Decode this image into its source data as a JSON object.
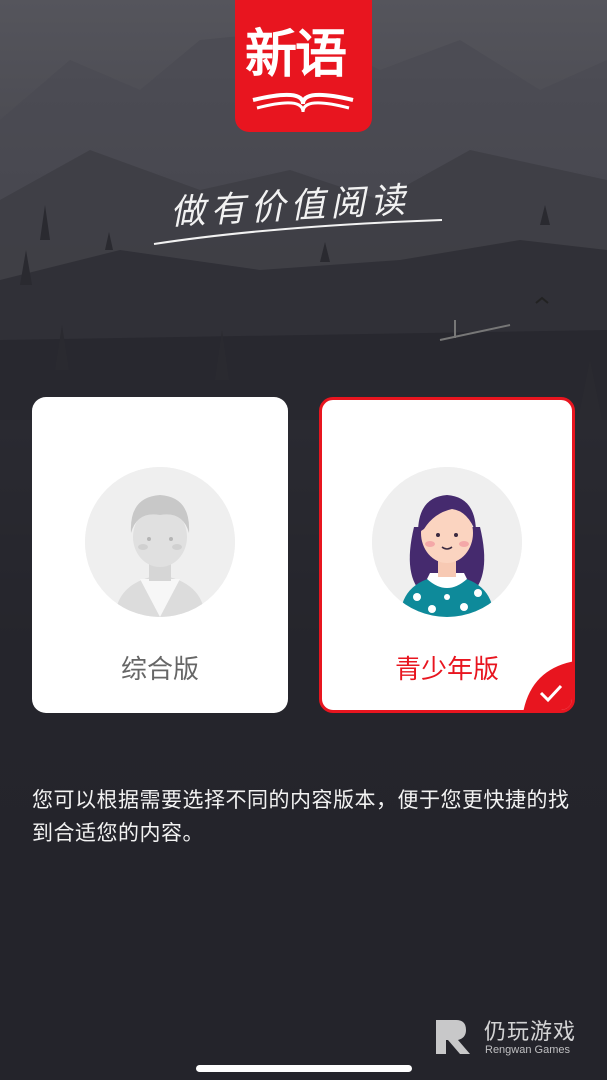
{
  "app": {
    "logo_text": "新语",
    "slogan": "做有价值阅读"
  },
  "options": [
    {
      "label": "综合版",
      "selected": false
    },
    {
      "label": "青少年版",
      "selected": true
    }
  ],
  "description": "您可以根据需要选择不同的内容版本，便于您更快捷的找到合适您的内容。",
  "watermark": {
    "title": "仍玩游戏",
    "subtitle": "Rengwan Games"
  },
  "colors": {
    "accent": "#e8151f",
    "background": "#23232a"
  }
}
